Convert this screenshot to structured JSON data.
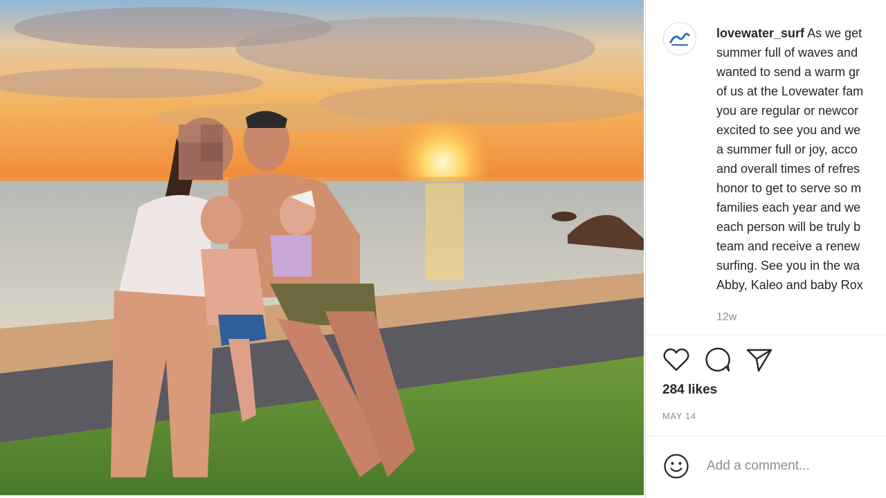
{
  "post": {
    "username": "lovewater_surf",
    "caption_lines": [
      "As we get",
      "summer full of waves and",
      "wanted to send a warm gr",
      "of us at the Lovewater fam",
      "you are regular or newcor",
      "excited to see you and we",
      "a summer full or joy, acco",
      "and overall times of refres",
      "honor to get to serve so m",
      "families each year and we",
      "each person will be truly b",
      "team and receive a renew",
      "surfing. See you in the wa",
      "Abby, Kaleo and baby Rox"
    ],
    "time_ago": "12w",
    "likes": "284 likes",
    "date": "MAY 14"
  },
  "comment": {
    "placeholder": "Add a comment..."
  },
  "icons": {
    "avatar": "wave-logo-icon",
    "like": "heart-icon",
    "comment": "comment-bubble-icon",
    "share": "paper-plane-icon",
    "emoji": "smiley-icon"
  },
  "colors": {
    "text": "#262626",
    "muted": "#8e8e8e",
    "logo_blue": "#2f6fb5"
  }
}
